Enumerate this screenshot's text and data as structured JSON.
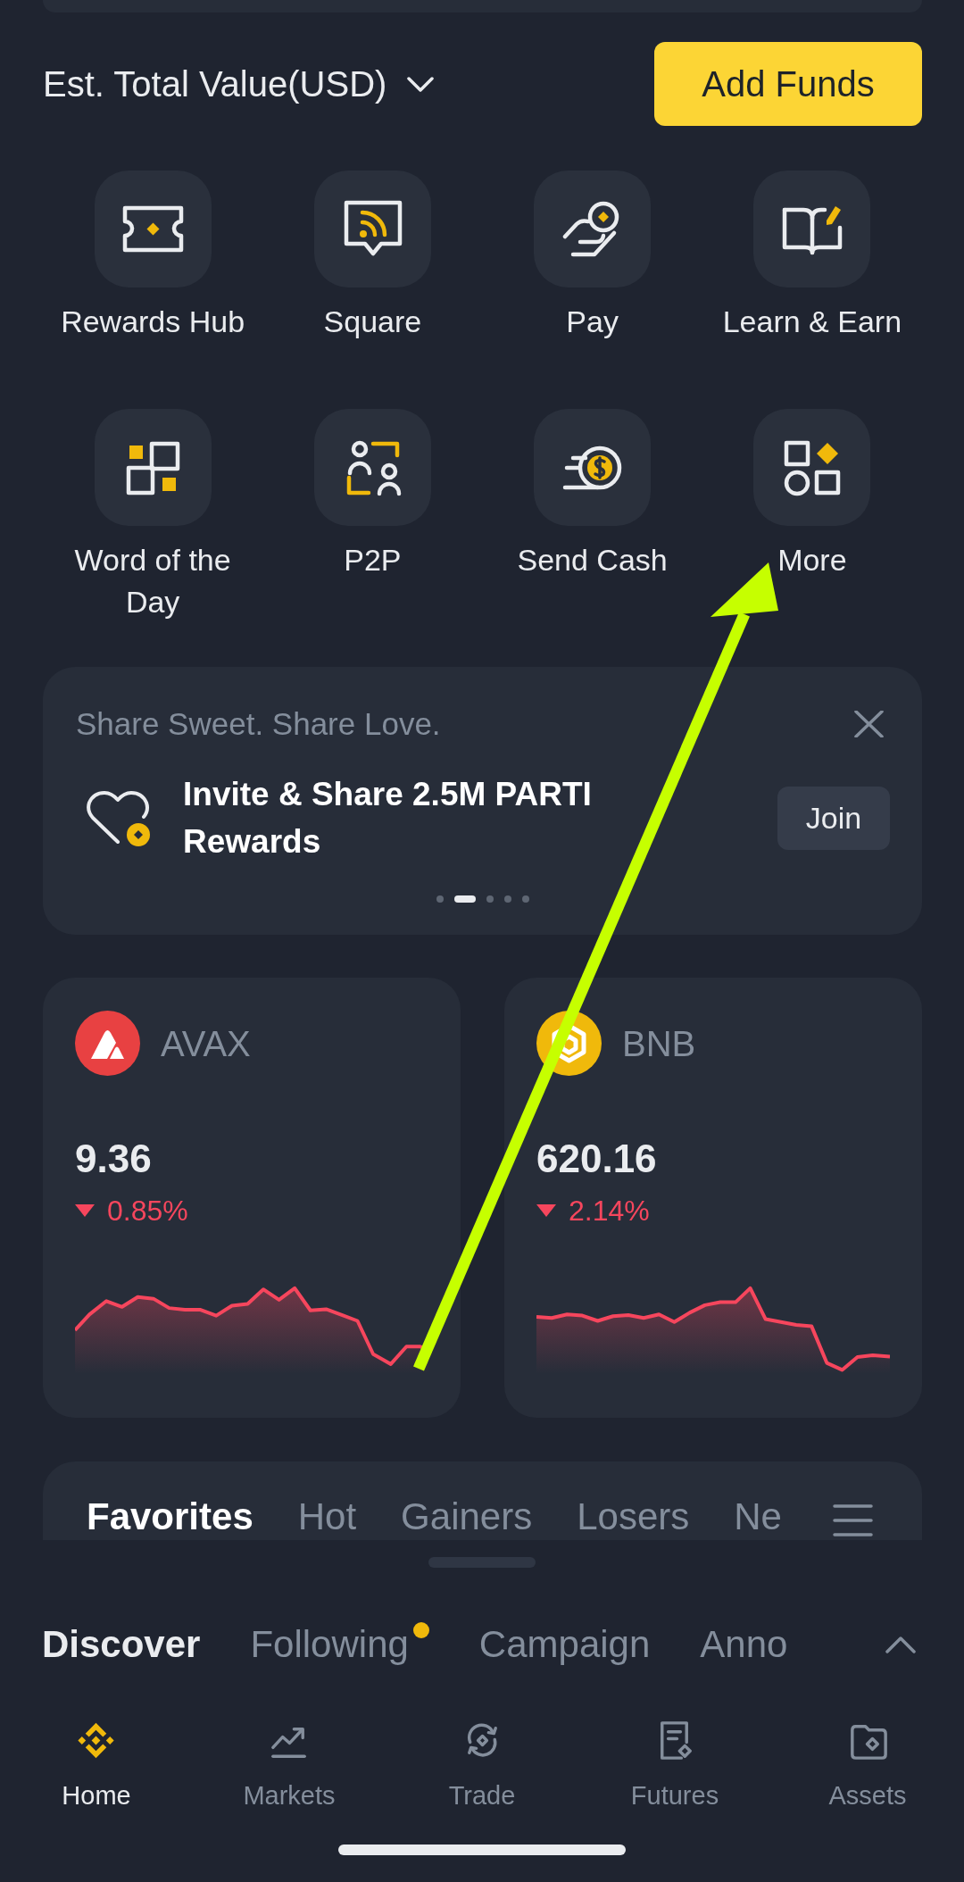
{
  "header": {
    "total_value_label": "Est. Total Value(USD)",
    "add_funds_button": "Add Funds"
  },
  "shortcuts": [
    {
      "label": "Rewards Hub"
    },
    {
      "label": "Square"
    },
    {
      "label": "Pay"
    },
    {
      "label": "Learn & Earn"
    },
    {
      "label": "Word of the Day"
    },
    {
      "label": "P2P"
    },
    {
      "label": "Send Cash"
    },
    {
      "label": "More"
    }
  ],
  "banner": {
    "subtitle": "Share Sweet. Share Love.",
    "title": "Invite & Share 2.5M PARTI Rewards",
    "button": "Join",
    "pages": [
      {
        "selected": false
      },
      {
        "selected": true
      },
      {
        "selected": false
      },
      {
        "selected": false
      },
      {
        "selected": false
      }
    ]
  },
  "coins": [
    {
      "symbol": "AVAX",
      "price": "9.36",
      "change": "0.85%",
      "falling": true
    },
    {
      "symbol": "BNB",
      "price": "620.16",
      "change": "2.14%",
      "falling": true
    }
  ],
  "market_tabs": [
    {
      "label": "Favorites",
      "selected": true
    },
    {
      "label": "Hot",
      "selected": false
    },
    {
      "label": "Gainers",
      "selected": false
    },
    {
      "label": "Losers",
      "selected": false
    },
    {
      "label": "Ne",
      "selected": false
    }
  ],
  "feed_tabs": [
    {
      "label": "Discover",
      "selected": true,
      "unread": false
    },
    {
      "label": "Following",
      "selected": false,
      "unread": true
    },
    {
      "label": "Campaign",
      "selected": false,
      "unread": false
    },
    {
      "label": "Anno",
      "selected": false,
      "unread": false
    }
  ],
  "bottom_nav": [
    {
      "label": "Home",
      "selected": true
    },
    {
      "label": "Markets",
      "selected": false
    },
    {
      "label": "Trade",
      "selected": false
    },
    {
      "label": "Futures",
      "selected": false
    },
    {
      "label": "Assets",
      "selected": false
    }
  ],
  "annotations": [
    {
      "kind": "arrow"
    }
  ]
}
